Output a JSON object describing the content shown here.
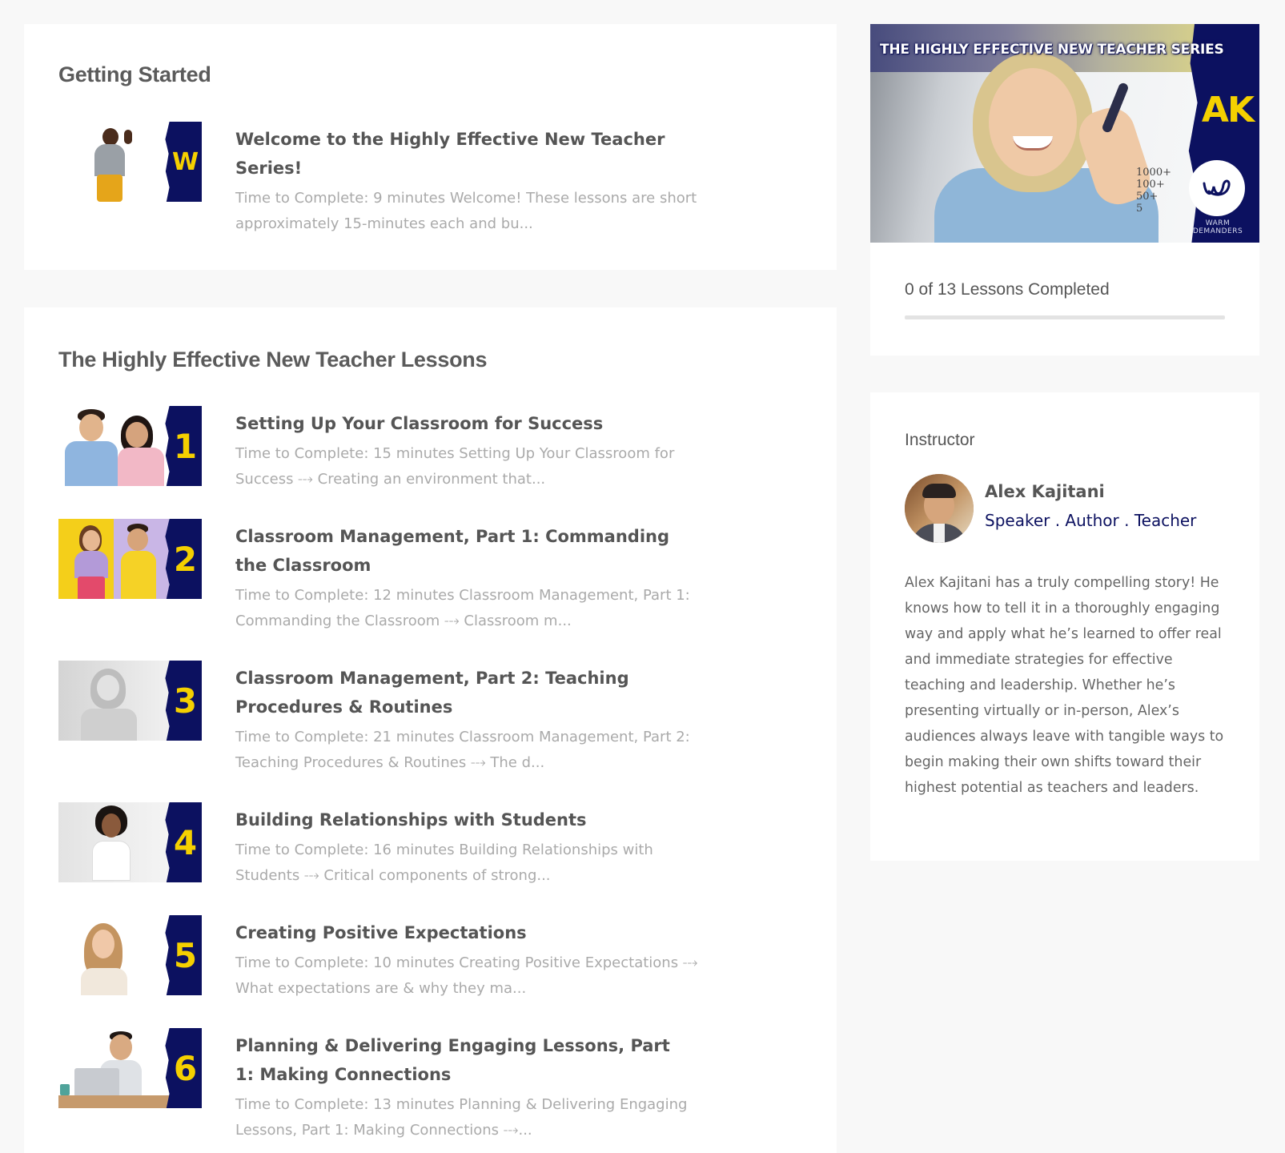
{
  "getting_started": {
    "title": "Getting Started",
    "lessons": [
      {
        "title": "Welcome to the Highly Effective New Teacher Series!",
        "description": "Time to Complete: 9 minutes Welcome! These lessons are short approximately 15-minutes each and bu...",
        "badge": "W"
      }
    ]
  },
  "lessons_section": {
    "title": "The Highly Effective New Teacher Lessons",
    "lessons": [
      {
        "title": "Setting Up Your Classroom for Success",
        "description": "Time to Complete: 15 minutes Setting Up Your Classroom for Success ⤏ Creating an environment that...",
        "badge": "1"
      },
      {
        "title": "Classroom Management, Part 1: Commanding the Classroom",
        "description": "Time to Complete: 12 minutes Classroom Management, Part 1: Commanding the Classroom ⤏ Classroom m...",
        "badge": "2"
      },
      {
        "title": "Classroom Management, Part 2: Teaching Procedures & Routines",
        "description": "Time to Complete: 21 minutes Classroom Management, Part 2: Teaching Procedures & Routines ⤏ The d...",
        "badge": "3"
      },
      {
        "title": "Building Relationships with Students",
        "description": "Time to Complete: 16 minutes Building Relationships with Students ⤏ Critical components of strong...",
        "badge": "4"
      },
      {
        "title": "Creating Positive Expectations",
        "description": "Time to Complete: 10 minutes Creating Positive Expectations ⤏ What expectations are & why they ma...",
        "badge": "5"
      },
      {
        "title": "Planning & Delivering Engaging Lessons, Part 1: Making Connections",
        "description": "Time to Complete: 13 minutes Planning & Delivering Engaging Lessons, Part 1: Making Connections ⤏...",
        "badge": "6"
      }
    ]
  },
  "course": {
    "banner": "THE HIGHLY EFFECTIVE NEW TEACHER SERIES",
    "monogram": "AK",
    "logo_text": "WARM DEMANDERS",
    "board_math": "1000+\n100+\n50+\n5",
    "progress_text": "0 of 13 Lessons Completed",
    "completed": 0,
    "total": 13
  },
  "instructor": {
    "heading": "Instructor",
    "name": "Alex Kajitani",
    "role": "Speaker . Author . Teacher",
    "bio": "Alex Kajitani has a truly compelling story! He knows how to tell it in a thoroughly engaging way and apply what he’s learned to offer real and immediate strategies for effective teaching and leadership. Whether he’s presenting virtually or in-person, Alex’s audiences always leave with tangible ways to begin making their own shifts toward their highest potential as teachers and leaders."
  },
  "colors": {
    "brand_navy": "#0c1160",
    "brand_yellow": "#f5d000",
    "page_bg": "#f8f8f8",
    "card_bg": "#ffffff"
  }
}
